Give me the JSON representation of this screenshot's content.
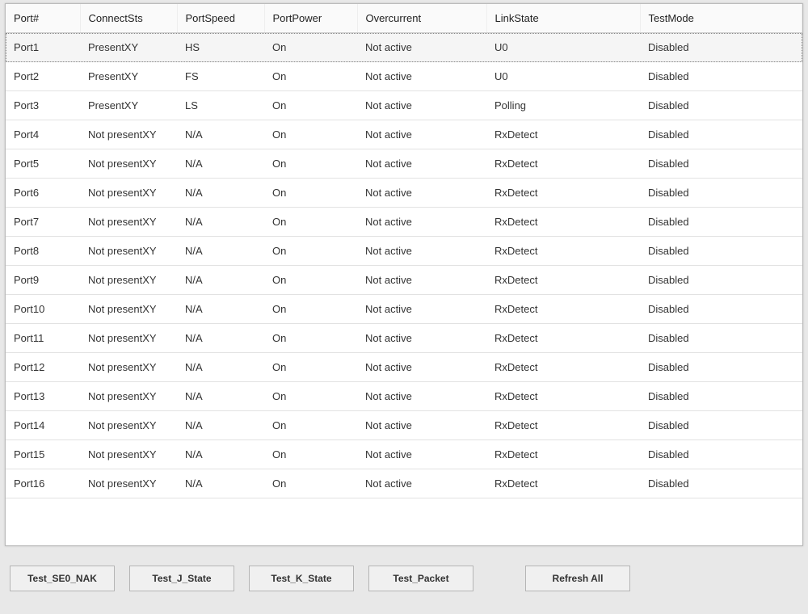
{
  "table": {
    "headers": [
      "Port#",
      "ConnectSts",
      "PortSpeed",
      "PortPower",
      "Overcurrent",
      "LinkState",
      "TestMode"
    ],
    "rows": [
      {
        "port": "Port1",
        "connect": "PresentXY",
        "speed": "HS",
        "power": "On",
        "over": "Not active",
        "link": "U0",
        "test": "Disabled",
        "selected": true
      },
      {
        "port": "Port2",
        "connect": "PresentXY",
        "speed": "FS",
        "power": "On",
        "over": "Not active",
        "link": "U0",
        "test": "Disabled",
        "selected": false
      },
      {
        "port": "Port3",
        "connect": "PresentXY",
        "speed": "LS",
        "power": "On",
        "over": "Not active",
        "link": "Polling",
        "test": "Disabled",
        "selected": false
      },
      {
        "port": "Port4",
        "connect": "Not presentXY",
        "speed": "N/A",
        "power": "On",
        "over": "Not active",
        "link": "RxDetect",
        "test": "Disabled",
        "selected": false
      },
      {
        "port": "Port5",
        "connect": "Not presentXY",
        "speed": "N/A",
        "power": "On",
        "over": "Not active",
        "link": "RxDetect",
        "test": "Disabled",
        "selected": false
      },
      {
        "port": "Port6",
        "connect": "Not presentXY",
        "speed": "N/A",
        "power": "On",
        "over": "Not active",
        "link": "RxDetect",
        "test": "Disabled",
        "selected": false
      },
      {
        "port": "Port7",
        "connect": "Not presentXY",
        "speed": "N/A",
        "power": "On",
        "over": "Not active",
        "link": "RxDetect",
        "test": "Disabled",
        "selected": false
      },
      {
        "port": "Port8",
        "connect": "Not presentXY",
        "speed": "N/A",
        "power": "On",
        "over": "Not active",
        "link": "RxDetect",
        "test": "Disabled",
        "selected": false
      },
      {
        "port": "Port9",
        "connect": "Not presentXY",
        "speed": "N/A",
        "power": "On",
        "over": "Not active",
        "link": "RxDetect",
        "test": "Disabled",
        "selected": false
      },
      {
        "port": "Port10",
        "connect": "Not presentXY",
        "speed": "N/A",
        "power": "On",
        "over": "Not active",
        "link": "RxDetect",
        "test": "Disabled",
        "selected": false
      },
      {
        "port": "Port11",
        "connect": "Not presentXY",
        "speed": "N/A",
        "power": "On",
        "over": "Not active",
        "link": "RxDetect",
        "test": "Disabled",
        "selected": false
      },
      {
        "port": "Port12",
        "connect": "Not presentXY",
        "speed": "N/A",
        "power": "On",
        "over": "Not active",
        "link": "RxDetect",
        "test": "Disabled",
        "selected": false
      },
      {
        "port": "Port13",
        "connect": "Not presentXY",
        "speed": "N/A",
        "power": "On",
        "over": "Not active",
        "link": "RxDetect",
        "test": "Disabled",
        "selected": false
      },
      {
        "port": "Port14",
        "connect": "Not presentXY",
        "speed": "N/A",
        "power": "On",
        "over": "Not active",
        "link": "RxDetect",
        "test": "Disabled",
        "selected": false
      },
      {
        "port": "Port15",
        "connect": "Not presentXY",
        "speed": "N/A",
        "power": "On",
        "over": "Not active",
        "link": "RxDetect",
        "test": "Disabled",
        "selected": false
      },
      {
        "port": "Port16",
        "connect": "Not presentXY",
        "speed": "N/A",
        "power": "On",
        "over": "Not active",
        "link": "RxDetect",
        "test": "Disabled",
        "selected": false
      }
    ]
  },
  "buttons": {
    "se0nak": "Test_SE0_NAK",
    "jstate": "Test_J_State",
    "kstate": "Test_K_State",
    "packet": "Test_Packet",
    "refresh": "Refresh All"
  }
}
